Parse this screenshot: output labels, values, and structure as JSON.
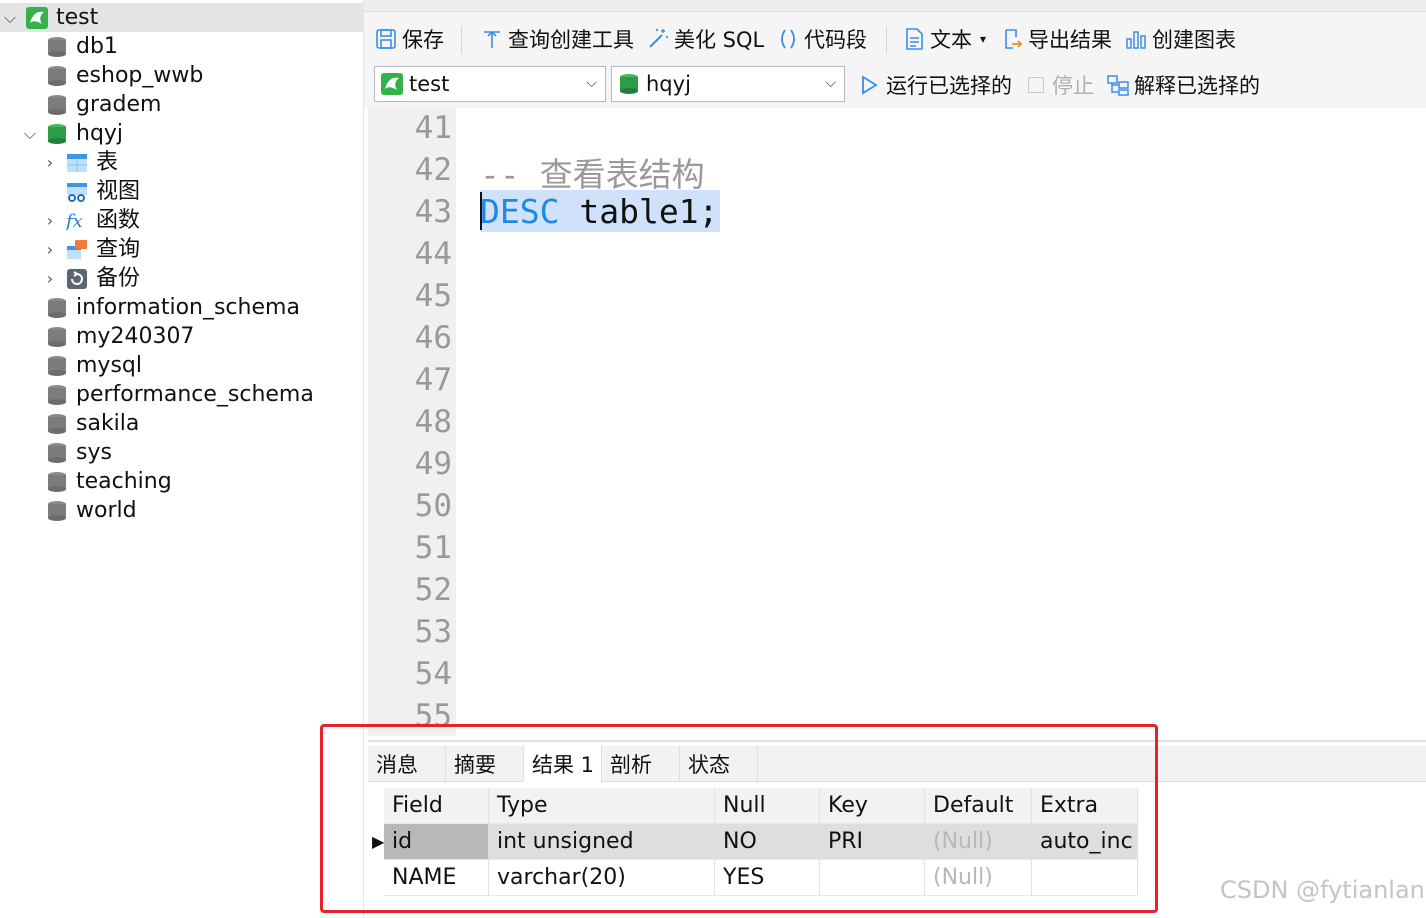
{
  "sidebar": {
    "connection": "test",
    "databases": [
      "db1",
      "eshop_wwb",
      "gradem"
    ],
    "open_db": "hqyj",
    "children": [
      "表",
      "视图",
      "函数",
      "查询",
      "备份"
    ],
    "databases_after": [
      "information_schema",
      "my240307",
      "mysql",
      "performance_schema",
      "sakila",
      "sys",
      "teaching",
      "world"
    ]
  },
  "toolbar": {
    "save": "保存",
    "query_builder": "查询创建工具",
    "beautify": "美化 SQL",
    "snippet": "代码段",
    "text": "文本",
    "export": "导出结果",
    "chart": "创建图表",
    "connection_select": "test",
    "database_select": "hqyj",
    "run_selected": "运行已选择的",
    "stop": "停止",
    "explain_selected": "解释已选择的"
  },
  "editor": {
    "line_numbers": [
      "41",
      "42",
      "43",
      "44",
      "45",
      "46",
      "47",
      "48",
      "49",
      "50",
      "51",
      "52",
      "53",
      "54",
      "55"
    ],
    "comment": "-- 查看表结构",
    "keyword": "DESC",
    "rest": " table1;"
  },
  "result": {
    "tabs": [
      "消息",
      "摘要",
      "结果 1",
      "剖析",
      "状态"
    ],
    "columns": [
      "Field",
      "Type",
      "Null",
      "Key",
      "Default",
      "Extra"
    ],
    "rows": [
      [
        "id",
        "int unsigned",
        "NO",
        "PRI",
        "(Null)",
        "auto_inc"
      ],
      [
        "NAME",
        "varchar(20)",
        "YES",
        "",
        "(Null)",
        ""
      ]
    ]
  },
  "watermark": "CSDN @fytianlan",
  "colors": {
    "keyword": "#1e88e5",
    "selection": "#cfe2fa",
    "highlight_box": "#e8222c",
    "db_open": "#2e9b48"
  }
}
